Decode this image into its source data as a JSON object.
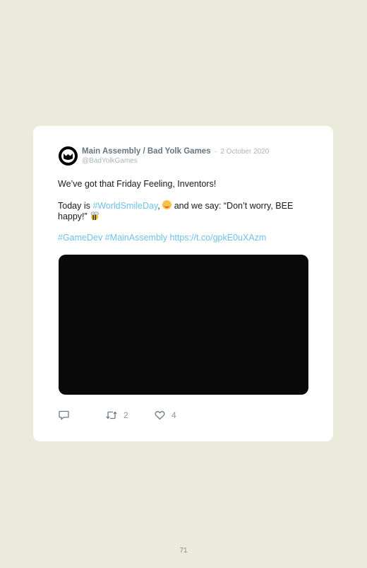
{
  "tweet": {
    "author": "Main Assembly / Bad Yolk Games",
    "separator": "·",
    "date": "2 October 2020",
    "handle": "@BadYolkGames",
    "line1": "We’ve got that Friday Feeling, Inventors!",
    "line2_pre": "Today is ",
    "line2_hashtag": "#WorldSmileDay",
    "line2_mid": ", ",
    "line2_post": " and we say: “Don’t worry, BEE happy!” ",
    "line3_hashtag1": "#GameDev",
    "line3_hashtag2": "#MainAssembly",
    "line3_link": "https://t.co/gpkE0uXAzm",
    "retweet_count": "2",
    "like_count": "4"
  },
  "icons": {
    "avatar": "bad-yolk-logo",
    "smile": "smiling-face-emoji",
    "bee": "honeybee-emoji",
    "reply": "reply-icon",
    "retweet": "retweet-icon",
    "like": "heart-icon"
  },
  "colors": {
    "page_bg": "#ebebdc",
    "card_bg": "#ffffff",
    "link": "#6ec2ea",
    "media": "#0a0909"
  },
  "page": {
    "number": "71"
  }
}
